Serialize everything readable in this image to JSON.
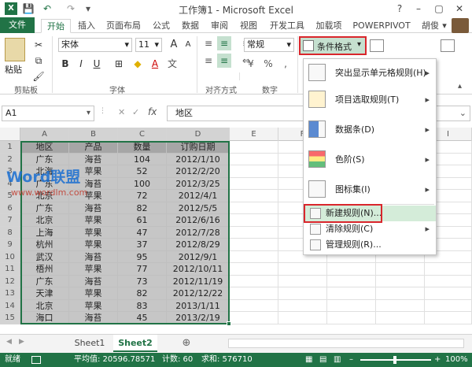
{
  "window": {
    "title": "工作簿1 - Microsoft Excel",
    "help": "?",
    "minimize": "–",
    "restore": "▢",
    "close": "✕"
  },
  "quick_access": {
    "save": "💾",
    "undo": "↶",
    "redo": "↷",
    "customize": "▾"
  },
  "tabs": [
    {
      "label": "文件"
    },
    {
      "label": "开始"
    },
    {
      "label": "插入"
    },
    {
      "label": "页面布局"
    },
    {
      "label": "公式"
    },
    {
      "label": "数据"
    },
    {
      "label": "审阅"
    },
    {
      "label": "视图"
    },
    {
      "label": "开发工具"
    },
    {
      "label": "加载项"
    },
    {
      "label": "POWERPIVOT"
    }
  ],
  "user": {
    "name": "胡俊",
    "dropdown": "▾"
  },
  "ribbon": {
    "paste_label": "粘贴",
    "clipboard_group": "剪贴板",
    "font_name": "宋体",
    "font_size": "11",
    "font_group": "字体",
    "align_group": "对齐方式",
    "number_format": "常规",
    "number_group": "数字",
    "bold": "B",
    "italic": "I",
    "underline": "U",
    "grow": "A",
    "shrink": "A",
    "font_color_letter": "A",
    "wrap": "≡",
    "percent": "%",
    "comma": ",",
    "currency": "¥",
    "conditional_format_button": "条件格式",
    "cf_dropdown": "▾",
    "font_dropdown": "▾",
    "size_dropdown": "▾",
    "number_dropdown": "▾",
    "collapse": "▴"
  },
  "formula_bar": {
    "name_box": "A1",
    "name_dropdown": "▾",
    "fx": "fx",
    "cancel": "✕",
    "enter": "✓",
    "content": "地区",
    "expand": "⌄"
  },
  "columns": [
    "A",
    "B",
    "C",
    "D",
    "E",
    "F",
    "G",
    "H",
    "I"
  ],
  "rows": [
    "1",
    "2",
    "3",
    "4",
    "5",
    "6",
    "7",
    "8",
    "9",
    "10",
    "11",
    "12",
    "13",
    "14",
    "15"
  ],
  "table": {
    "headers": [
      "地区",
      "产品",
      "数量",
      "订购日期"
    ],
    "rows": [
      [
        "广东",
        "海苔",
        "104",
        "2012/1/10"
      ],
      [
        "北海",
        "苹果",
        "52",
        "2012/2/20"
      ],
      [
        "广东",
        "海苔",
        "100",
        "2012/3/25"
      ],
      [
        "北京",
        "苹果",
        "72",
        "2012/4/1"
      ],
      [
        "广东",
        "海苔",
        "82",
        "2012/5/5"
      ],
      [
        "北京",
        "苹果",
        "61",
        "2012/6/16"
      ],
      [
        "上海",
        "苹果",
        "47",
        "2012/7/28"
      ],
      [
        "杭州",
        "苹果",
        "37",
        "2012/8/29"
      ],
      [
        "武汉",
        "海苔",
        "95",
        "2012/9/1"
      ],
      [
        "梧州",
        "苹果",
        "77",
        "2012/10/11"
      ],
      [
        "广东",
        "海苔",
        "73",
        "2012/11/19"
      ],
      [
        "天津",
        "苹果",
        "82",
        "2012/12/22"
      ],
      [
        "北京",
        "苹果",
        "83",
        "2013/1/11"
      ],
      [
        "海口",
        "海苔",
        "45",
        "2013/2/19"
      ]
    ]
  },
  "cf_menu": {
    "items": [
      {
        "label": "突出显示单元格规则(H)",
        "arrow": "▸"
      },
      {
        "label": "项目选取规则(T)",
        "arrow": "▸"
      },
      {
        "label": "数据条(D)",
        "arrow": "▸"
      },
      {
        "label": "色阶(S)",
        "arrow": "▸"
      },
      {
        "label": "图标集(I)",
        "arrow": "▸"
      },
      {
        "label": "新建规则(N)..."
      },
      {
        "label": "清除规则(C)",
        "arrow": "▸"
      },
      {
        "label": "管理规则(R)..."
      }
    ]
  },
  "sheets": {
    "nav_prev": "◀",
    "nav_next": "▶",
    "items": [
      "Sheet1",
      "Sheet2"
    ],
    "add": "⊕"
  },
  "status": {
    "ready": "就绪",
    "average": "平均值: 20596.78571",
    "count": "计数: 60",
    "sum": "求和: 576710",
    "zoom": "100%",
    "zoom_minus": "–",
    "zoom_plus": "+"
  },
  "watermark": {
    "logo": "Word联盟",
    "url": "www.wordlm.com"
  },
  "colors": {
    "excel_green": "#217346",
    "highlight_red": "#d9262c",
    "selection_gray": "#c6c6c6"
  }
}
